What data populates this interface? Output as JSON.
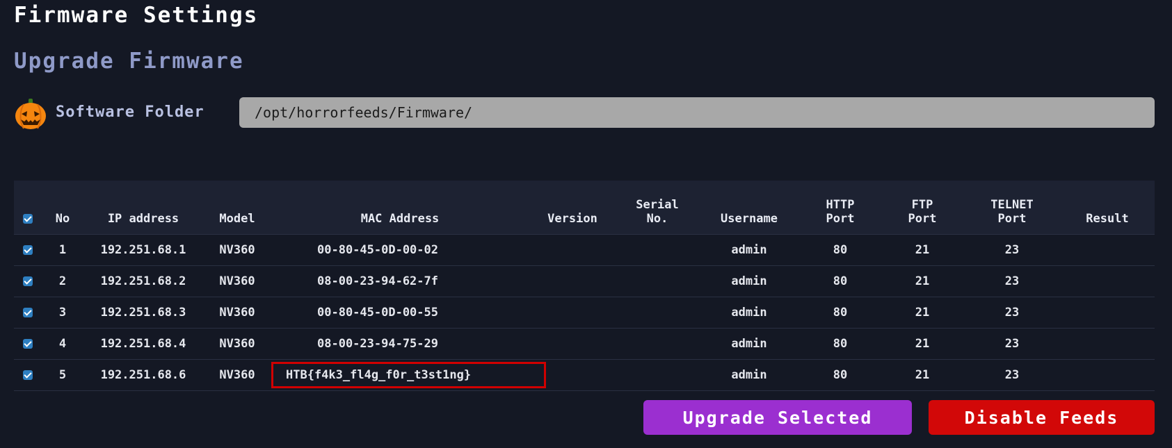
{
  "header": {
    "title": "Firmware Settings",
    "section": "Upgrade Firmware"
  },
  "folder": {
    "label": "Software Folder",
    "value": "/opt/horrorfeeds/Firmware/",
    "icon": "pumpkin-icon"
  },
  "table": {
    "columns": {
      "no": "No",
      "ip": "IP address",
      "model": "Model",
      "mac": "MAC Address",
      "version": "Version",
      "serial_1": "Serial",
      "serial_2": "No.",
      "username": "Username",
      "http_1": "HTTP",
      "http_2": "Port",
      "ftp_1": "FTP",
      "ftp_2": "Port",
      "telnet_1": "TELNET",
      "telnet_2": "Port",
      "result": "Result"
    },
    "rows": [
      {
        "no": "1",
        "ip": "192.251.68.1",
        "model": "NV360",
        "mac": "00-80-45-0D-00-02",
        "version": "",
        "serial": "",
        "username": "admin",
        "http": "80",
        "ftp": "21",
        "telnet": "23",
        "result": ""
      },
      {
        "no": "2",
        "ip": "192.251.68.2",
        "model": "NV360",
        "mac": "08-00-23-94-62-7f",
        "version": "",
        "serial": "",
        "username": "admin",
        "http": "80",
        "ftp": "21",
        "telnet": "23",
        "result": ""
      },
      {
        "no": "3",
        "ip": "192.251.68.3",
        "model": "NV360",
        "mac": "00-80-45-0D-00-55",
        "version": "",
        "serial": "",
        "username": "admin",
        "http": "80",
        "ftp": "21",
        "telnet": "23",
        "result": ""
      },
      {
        "no": "4",
        "ip": "192.251.68.4",
        "model": "NV360",
        "mac": "08-00-23-94-75-29",
        "version": "",
        "serial": "",
        "username": "admin",
        "http": "80",
        "ftp": "21",
        "telnet": "23",
        "result": ""
      },
      {
        "no": "5",
        "ip": "192.251.68.6",
        "model": "NV360",
        "mac": "HTB{f4k3_fl4g_f0r_t3st1ng}",
        "version": "",
        "serial": "",
        "username": "admin",
        "http": "80",
        "ftp": "21",
        "telnet": "23",
        "result": ""
      }
    ]
  },
  "actions": {
    "upgrade": "Upgrade Selected",
    "disable": "Disable Feeds"
  },
  "colors": {
    "background": "#141824",
    "upgrade_button": "#9b2fd0",
    "disable_button": "#d20808",
    "highlight_border": "#d00000"
  }
}
